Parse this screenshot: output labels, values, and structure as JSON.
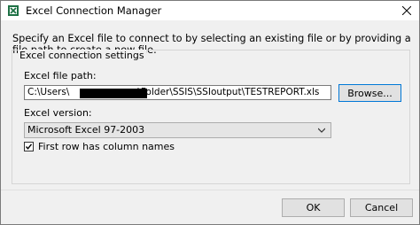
{
  "window": {
    "title": "Excel Connection Manager",
    "icon": "excel-connection-icon",
    "close_icon": "close-icon"
  },
  "description": "Specify an Excel file to connect to by selecting an existing file or by providing a file path to create a new file.",
  "settings": {
    "group_label": "Excel connection settings",
    "file_path_label": "Excel file path:",
    "file_path_value": "C:\\Users\\██████████\\Folder\\SSIS\\SSIoutput\\TESTREPORT.xls",
    "file_path_prefix": "C:\\Users\\",
    "file_path_suffix": "\\Folder\\SSIS\\SSIoutput\\TESTREPORT.xls",
    "browse_label": "Browse...",
    "version_label": "Excel version:",
    "version_value": "Microsoft Excel 97-2003",
    "first_row_label": "First row has column names",
    "first_row_checked": true
  },
  "buttons": {
    "ok": "OK",
    "cancel": "Cancel"
  },
  "colors": {
    "accent": "#0078d7",
    "background": "#f0f0f0",
    "excel_green": "#1e7145"
  }
}
